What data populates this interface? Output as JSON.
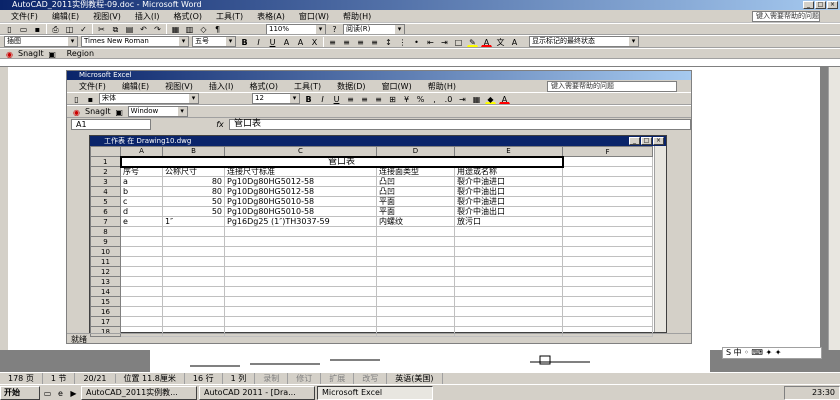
{
  "word": {
    "title": "AutoCAD_2011实例教程-09.doc - Microsoft Word",
    "menus": [
      "文件(F)",
      "编辑(E)",
      "视图(V)",
      "插入(I)",
      "格式(O)",
      "工具(T)",
      "表格(A)",
      "窗口(W)",
      "帮助(H)"
    ],
    "help_placeholder": "键入需要帮助的问题",
    "zoom": "110%",
    "read_mode": "阅读(R)",
    "style": "插图",
    "font": "Times New Roman",
    "font_size": "五号",
    "show_markup": "显示标记的最终状态",
    "snagit": "SnagIt",
    "region": "Region"
  },
  "excel": {
    "title": "Microsoft Excel",
    "menus": [
      "文件(F)",
      "编辑(E)",
      "视图(V)",
      "插入(I)",
      "格式(O)",
      "工具(T)",
      "数据(D)",
      "窗口(W)",
      "帮助(H)"
    ],
    "help_placeholder": "键入需要帮助的问题",
    "font": "宋体",
    "font_size": "12",
    "snagit": "SnagIt",
    "window": "Window",
    "name_box": "A1",
    "fx": "fx",
    "formula": "管口表",
    "status": "就绪",
    "workbook_title": "工作表 在 Drawing10.dwg",
    "columns": [
      "A",
      "B",
      "C",
      "D",
      "E",
      "F"
    ],
    "merged_title": "管口表",
    "rows": [
      [
        "序号",
        "公称尺寸",
        "连接尺寸标准",
        "连接面类型",
        "用途或名称"
      ],
      [
        "a",
        "80",
        "Pg10Dg80HG5012-58",
        "凸凹",
        "裂介中油进口"
      ],
      [
        "b",
        "80",
        "Pg10Dg80HG5012-58",
        "凸凹",
        "裂介中油出口"
      ],
      [
        "c",
        "50",
        "Pg10Dg80HG5010-58",
        "平面",
        "裂介中油进口"
      ],
      [
        "d",
        "50",
        "Pg10Dg80HG5010-58",
        "平面",
        "裂介中油出口"
      ],
      [
        "e",
        "1″",
        "Pg16Dg25 (1″)TH3037-59",
        "内螺纹",
        "放污口"
      ]
    ],
    "row_numbers": [
      "1",
      "2",
      "3",
      "4",
      "5",
      "6",
      "7",
      "8",
      "9",
      "10",
      "11",
      "12",
      "13",
      "14",
      "15",
      "16",
      "17",
      "18"
    ]
  },
  "status": {
    "page": "178 页",
    "section": "1 节",
    "pages": "20/21",
    "position": "位置 11.8厘米",
    "line": "16 行",
    "col": "1 列",
    "rec": "录制",
    "trk": "修订",
    "ext": "扩展",
    "ovr": "改写",
    "lang": "英语(美国)"
  },
  "taskbar": {
    "start": "开始",
    "tasks": [
      "AutoCAD_2011实例教...",
      "AutoCAD 2011 - [Dra...",
      "Microsoft Excel"
    ],
    "clock": "23:30"
  }
}
